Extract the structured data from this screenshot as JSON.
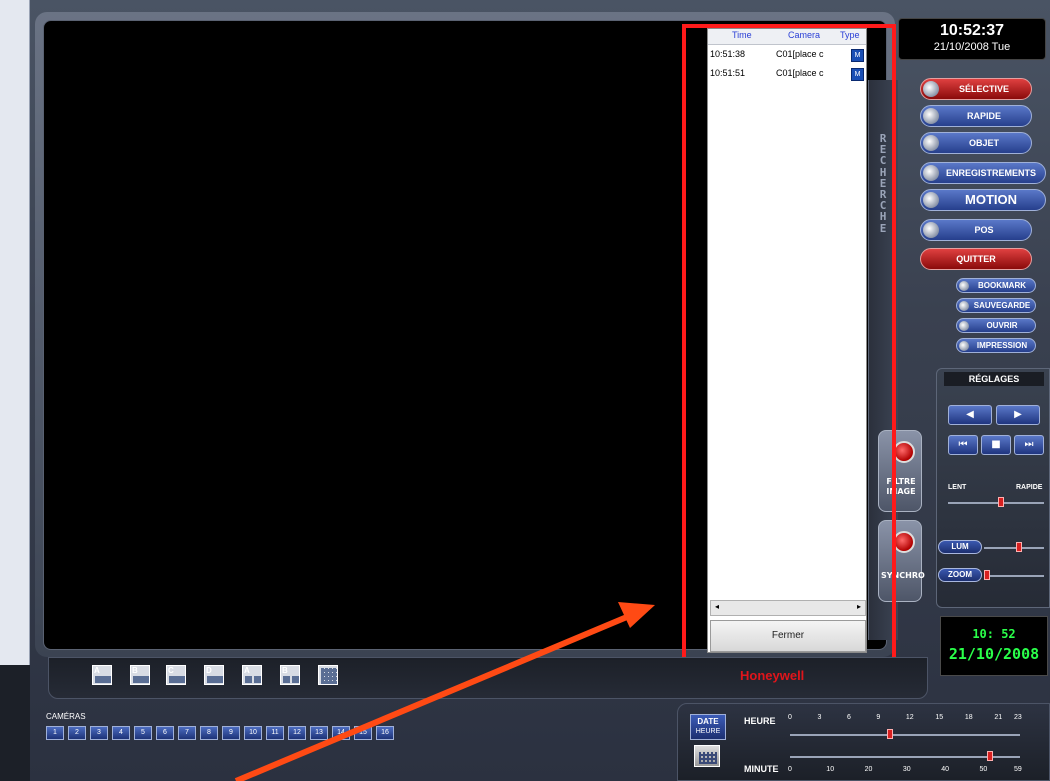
{
  "clock": {
    "time": "10:52:37",
    "date": "21/10/2008 Tue"
  },
  "events": {
    "headers": {
      "time": "Time",
      "camera": "Camera",
      "type": "Type"
    },
    "rows": [
      {
        "time": "10:51:38",
        "camera": "C01[place c",
        "type": "M"
      },
      {
        "time": "10:51:51",
        "camera": "C01[place c",
        "type": "M"
      }
    ],
    "close_label": "Fermer",
    "scroll_left": "◂",
    "scroll_right": "▸"
  },
  "vertical_tab": {
    "letters": [
      "R",
      "E",
      "C",
      "H",
      "E",
      "R",
      "C",
      "H",
      "E"
    ]
  },
  "side_buttons": {
    "filter": {
      "label": "FILTRE IMAGE"
    },
    "sync": {
      "label": "SYNCHRO"
    }
  },
  "menu": {
    "selective": "SÉLECTIVE",
    "rapide": "RAPIDE",
    "objet": "OBJET",
    "enregistrements": "ENREGISTREMENTS",
    "motion": "MOTION",
    "pos": "POS",
    "quitter": "QUITTER",
    "bookmark": "BOOKMARK",
    "sauvegarde": "SAUVEGARDE",
    "ouvrir": "OUVRIR",
    "impression": "IMPRESSION"
  },
  "reglages": {
    "title": "RÉGLAGES",
    "prev_icon": "◀",
    "next_icon": "▶",
    "first_icon": "⏮",
    "stop_icon": "■",
    "last_icon": "⏭",
    "speed_slow": "LENT",
    "speed_fast": "RAPIDE",
    "speed_level": 0.55,
    "lum": "LUM",
    "lum_level": 0.6,
    "zoom": "ZOOM",
    "zoom_level": 0.0
  },
  "lcd": {
    "time": "10: 52",
    "date": "21/10/2008"
  },
  "layouts": [
    "A",
    "B",
    "C",
    "D",
    "A",
    "B",
    ""
  ],
  "brand": "Honeywell",
  "cameras": {
    "label": "CAMÉRAS",
    "items": [
      "1",
      "2",
      "3",
      "4",
      "5",
      "6",
      "7",
      "8",
      "9",
      "10",
      "11",
      "12",
      "13",
      "14",
      "15",
      "16"
    ]
  },
  "date_control": {
    "date_label": "DATE",
    "heure_sub": "HEURE",
    "heure_label": "HEURE",
    "minute_label": "MINUTE",
    "hour_ticks": [
      "0",
      "3",
      "6",
      "9",
      "12",
      "15",
      "18",
      "21",
      "23"
    ],
    "minute_ticks": [
      "0",
      "10",
      "20",
      "30",
      "40",
      "50",
      "59"
    ],
    "hour_value": 10,
    "minute_value": 52
  },
  "colors": {
    "highlight": "#ff1a1a",
    "arrow": "#ff4a14",
    "brand": "#e0151b",
    "lcd": "#2aff4a"
  }
}
